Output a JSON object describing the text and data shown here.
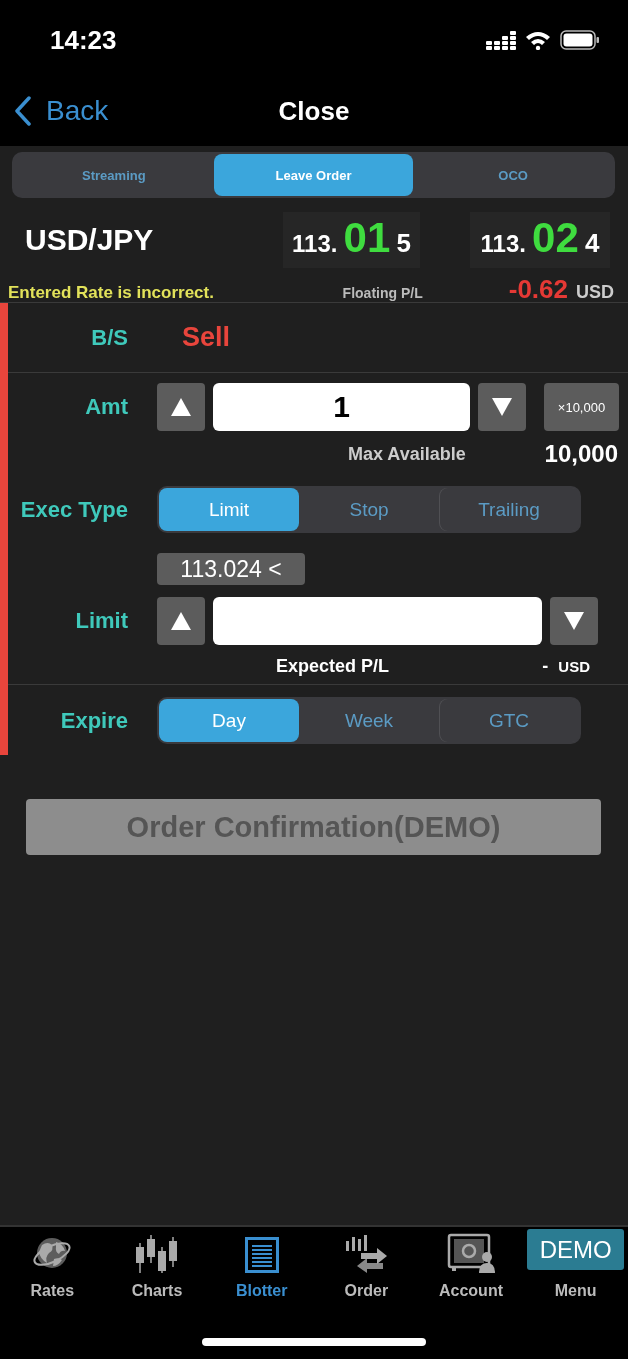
{
  "status_bar": {
    "time": "14:23"
  },
  "nav_bar": {
    "back_label": "Back",
    "title": "Close"
  },
  "order_tabs": [
    {
      "label": "Streaming",
      "selected": false
    },
    {
      "label": "Leave Order",
      "selected": true
    },
    {
      "label": "OCO",
      "selected": false
    }
  ],
  "quote": {
    "pair": "USD/JPY",
    "bid": {
      "prefix": "113.",
      "pips": "01",
      "fraction": "5"
    },
    "ask": {
      "prefix": "113.",
      "pips": "02",
      "fraction": "4"
    },
    "message": "Entered Rate is incorrect.",
    "floating_pl_label": "Floating P/L",
    "floating_pl_value": "-0.62",
    "floating_pl_currency": "USD"
  },
  "form": {
    "side": {
      "label": "B/S",
      "value": "Sell",
      "kind": "sell"
    },
    "amount": {
      "label": "Amt",
      "value": "1",
      "multiplier": "×10,000",
      "max_label": "Max Available",
      "max_value": "10,000"
    },
    "exec_type": {
      "label": "Exec Type",
      "options": [
        {
          "label": "Limit",
          "selected": true
        },
        {
          "label": "Stop",
          "selected": false
        },
        {
          "label": "Trailing",
          "selected": false
        }
      ]
    },
    "rate_hint": "113.024 <",
    "limit": {
      "label": "Limit",
      "expected_label": "Expected P/L",
      "expected_value": "-",
      "expected_currency": "USD"
    },
    "expire": {
      "label": "Expire",
      "options": [
        {
          "label": "Day",
          "selected": true
        },
        {
          "label": "Week",
          "selected": false
        },
        {
          "label": "GTC",
          "selected": false
        }
      ]
    }
  },
  "confirm_button": {
    "label": "Order Confirmation(DEMO)",
    "disabled": true
  },
  "tab_bar": [
    {
      "label": "Rates",
      "selected": false
    },
    {
      "label": "Charts",
      "selected": false
    },
    {
      "label": "Blotter",
      "selected": true
    },
    {
      "label": "Order",
      "selected": false
    },
    {
      "label": "Account",
      "selected": false
    },
    {
      "label": "Menu",
      "selected": false,
      "badge": "DEMO"
    }
  ]
}
